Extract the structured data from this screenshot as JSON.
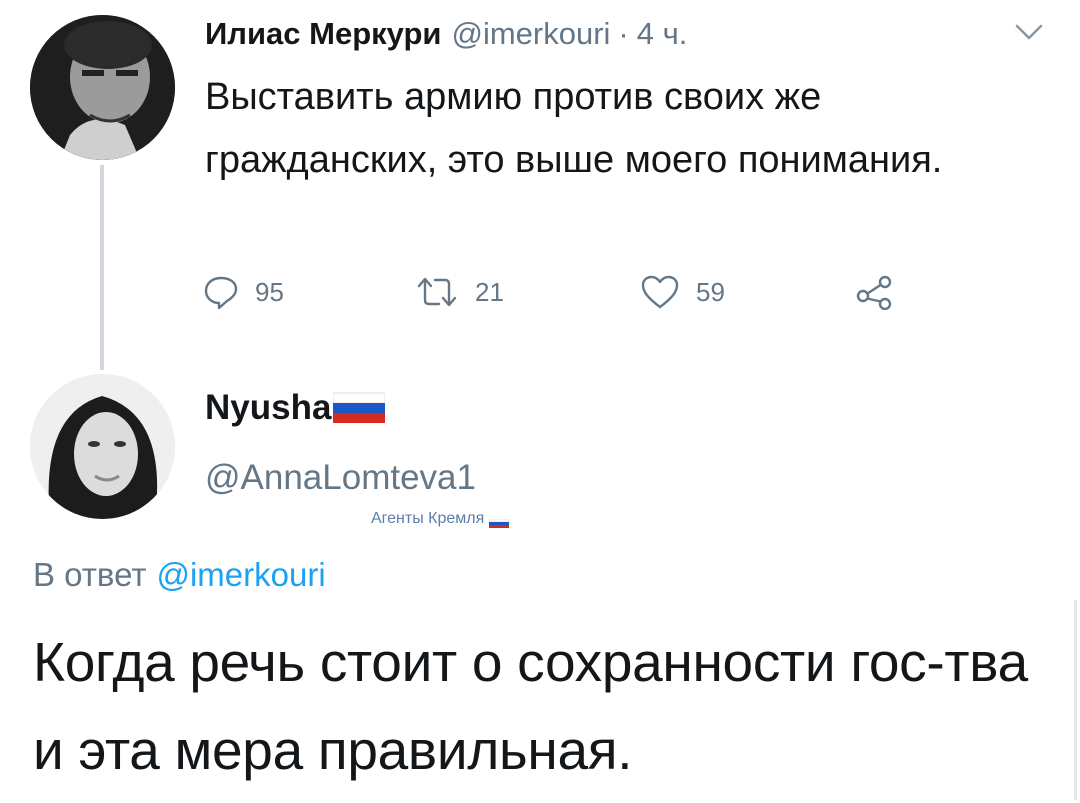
{
  "tweet_main": {
    "author_name": "Илиас Меркури",
    "author_handle": "@imerkouri",
    "separator": "·",
    "time": "4 ч.",
    "text": "Выставить армию против своих же гражданских, это выше моего понимания.",
    "actions": {
      "reply_count": "95",
      "retweet_count": "21",
      "like_count": "59"
    }
  },
  "tweet_reply": {
    "author_name": "Nyusha",
    "author_handle": "@AnnaLomteva1",
    "badge_text": "Агенты Кремля",
    "reply_prefix": "В ответ",
    "reply_mention": "@imerkouri",
    "text": "Когда речь стоит о сохранности гос-тва и эта мера правильная."
  },
  "colors": {
    "text_primary": "#14171a",
    "text_secondary": "#657786",
    "link": "#1da1f2",
    "thread_line": "#d0d6dc"
  },
  "icons": {
    "reply": "reply-icon",
    "retweet": "retweet-icon",
    "like": "heart-icon",
    "share": "share-icon",
    "caret": "chevron-down-icon"
  }
}
